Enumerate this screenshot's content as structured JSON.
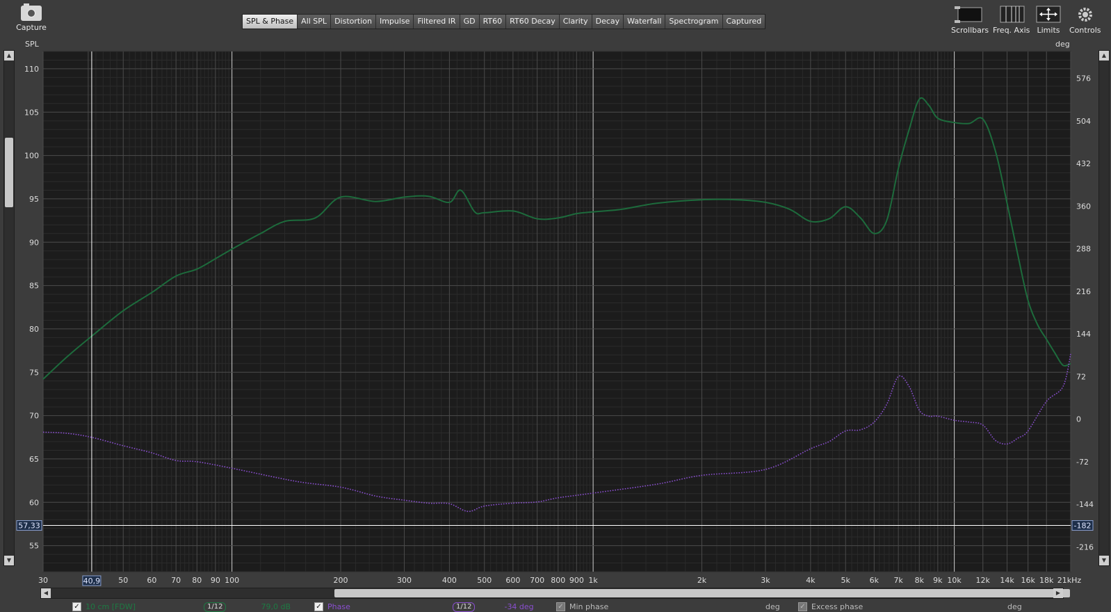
{
  "capture_label": "Capture",
  "tabs": [
    "SPL & Phase",
    "All SPL",
    "Distortion",
    "Impulse",
    "Filtered IR",
    "GD",
    "RT60",
    "RT60 Decay",
    "Clarity",
    "Decay",
    "Waterfall",
    "Spectrogram",
    "Captured"
  ],
  "tools": {
    "scrollbars": "Scrollbars",
    "freq_axis": "Freq. Axis",
    "limits": "Limits",
    "controls": "Controls"
  },
  "left_axis_title": "SPL",
  "right_axis_title": "deg",
  "cursor": {
    "freq_label": "40,9",
    "spl_label": "57,33",
    "phase_label": "-182"
  },
  "colors": {
    "spl": "#1d6b3c",
    "phase": "#8a4fd0",
    "grid": "#4a4a4a",
    "plot_bg": "#1c1c1c",
    "cursor": "#ffffff"
  },
  "legend": {
    "spl_name": "10 cm [FDW]",
    "spl_smoothing": "1/12",
    "spl_value": "79,0 dB",
    "phase_name": "Phase",
    "phase_smoothing": "1/12",
    "phase_value": "-34 deg",
    "min_phase": "Min phase",
    "min_phase_unit": "deg",
    "excess_phase": "Excess phase",
    "excess_phase_unit": "deg"
  },
  "chart_data": {
    "type": "line",
    "x_scale": "log",
    "xlim": [
      30,
      21000
    ],
    "ylim_left": [
      52,
      112
    ],
    "ylim_right": [
      -257.8,
      621.3
    ],
    "x_ticks": [
      30,
      40,
      50,
      60,
      70,
      80,
      90,
      100,
      200,
      300,
      400,
      500,
      600,
      700,
      800,
      900,
      1000,
      2000,
      3000,
      4000,
      5000,
      6000,
      7000,
      8000,
      9000,
      10000,
      12000,
      14000,
      16000,
      18000,
      21000
    ],
    "x_tick_labels": [
      "30",
      "40",
      "50",
      "60",
      "70",
      "80",
      "90",
      "100",
      "200",
      "300",
      "400",
      "500",
      "600",
      "700",
      "800",
      "900",
      "1k",
      "2k",
      "3k",
      "4k",
      "5k",
      "6k",
      "7k",
      "8k",
      "9k",
      "10k",
      "12k",
      "14k",
      "16k",
      "18k",
      "21kHz"
    ],
    "y_left_ticks": [
      55,
      60,
      65,
      70,
      75,
      80,
      85,
      90,
      95,
      100,
      105,
      110
    ],
    "y_right_ticks": [
      -216,
      -144,
      -72,
      0,
      72,
      144,
      216,
      288,
      360,
      432,
      504,
      576
    ],
    "grid": true,
    "series": [
      {
        "name": "10 cm [FDW]",
        "axis": "left",
        "style": "solid",
        "x": [
          30,
          35,
          41,
          50,
          60,
          70,
          80,
          90,
          100,
          120,
          140,
          170,
          200,
          250,
          300,
          350,
          400,
          430,
          470,
          500,
          600,
          700,
          800,
          900,
          1000,
          1200,
          1500,
          2000,
          2500,
          3000,
          3500,
          4000,
          4500,
          5000,
          5500,
          6000,
          6500,
          7000,
          7500,
          8000,
          8500,
          9000,
          10000,
          11000,
          12000,
          13000,
          14000,
          15000,
          16000,
          17000,
          18000,
          19000,
          20000,
          21000
        ],
        "values": [
          74.2,
          76.8,
          79.2,
          82.1,
          84.2,
          86.1,
          86.9,
          88.1,
          89.2,
          91.0,
          92.4,
          92.8,
          95.2,
          94.7,
          95.2,
          95.3,
          94.6,
          96.0,
          93.5,
          93.4,
          93.6,
          92.7,
          92.8,
          93.3,
          93.5,
          93.8,
          94.5,
          94.9,
          94.9,
          94.6,
          93.8,
          92.4,
          92.7,
          94.1,
          92.8,
          91.0,
          92.5,
          98.5,
          103.0,
          106.5,
          105.8,
          104.3,
          103.8,
          103.7,
          104.2,
          100.5,
          94.5,
          88.5,
          83.3,
          80.5,
          78.8,
          77.2,
          75.8,
          76.0
        ]
      },
      {
        "name": "Phase",
        "axis": "right",
        "style": "dotted",
        "x": [
          30,
          35,
          41,
          50,
          60,
          70,
          80,
          100,
          150,
          200,
          250,
          300,
          350,
          400,
          450,
          500,
          600,
          700,
          800,
          1000,
          1500,
          2000,
          3000,
          4000,
          4500,
          5000,
          5500,
          6000,
          6500,
          7000,
          7500,
          8000,
          8500,
          9000,
          10000,
          11000,
          12000,
          13000,
          14000,
          15000,
          16000,
          18000,
          20000,
          21000
        ],
        "values": [
          -22,
          -24,
          -31,
          -45,
          -57,
          -70,
          -72,
          -83,
          -105,
          -115,
          -130,
          -137,
          -142,
          -143,
          -156,
          -147,
          -142,
          -140,
          -133,
          -125,
          -110,
          -95,
          -85,
          -50,
          -38,
          -20,
          -18,
          -5,
          25,
          72,
          55,
          15,
          5,
          5,
          -2,
          -5,
          -10,
          -36,
          -42,
          -32,
          -20,
          30,
          55,
          110
        ]
      }
    ]
  }
}
